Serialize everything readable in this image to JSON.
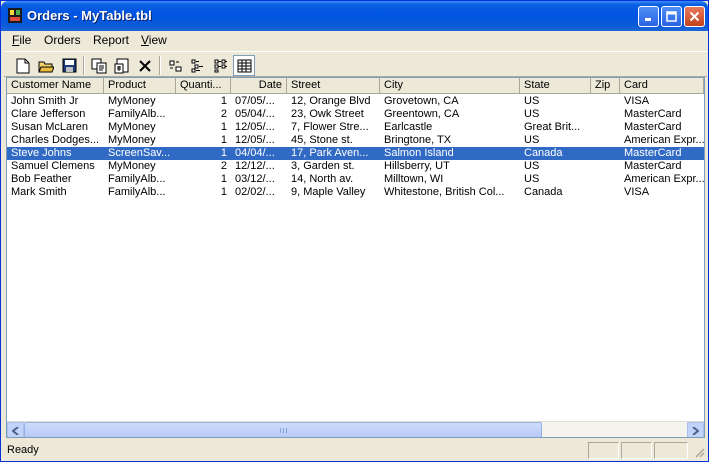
{
  "window": {
    "title": "Orders - MyTable.tbl"
  },
  "menu": [
    "File",
    "Orders",
    "Report",
    "View"
  ],
  "menu_underline": [
    "F",
    "",
    "",
    "V"
  ],
  "toolbar": {
    "buttons": [
      "new-document-icon",
      "open-folder-icon",
      "save-icon",
      "copy-icon",
      "properties-icon",
      "delete-icon",
      "large-icons-view-icon",
      "small-icons-view-icon",
      "list-view-icon",
      "details-view-icon"
    ]
  },
  "table": {
    "columns": [
      "Customer Name",
      "Product",
      "Quanti...",
      "Date",
      "Street",
      "City",
      "State",
      "Zip",
      "Card"
    ],
    "rows": [
      [
        "John Smith Jr",
        "MyMoney",
        "1",
        "07/05/...",
        "12, Orange Blvd",
        "Grovetown, CA",
        "US",
        "",
        "VISA"
      ],
      [
        "Clare Jefferson",
        "FamilyAlb...",
        "2",
        "05/04/...",
        "23, Owk Street",
        "Greentown, CA",
        "US",
        "",
        "MasterCard"
      ],
      [
        "Susan McLaren",
        "MyMoney",
        "1",
        "12/05/...",
        "7, Flower Stre...",
        "Earlcastle",
        "Great Brit...",
        "",
        "MasterCard"
      ],
      [
        "Charles Dodges...",
        "MyMoney",
        "1",
        "12/05/...",
        "45, Stone st.",
        "Bringtone, TX",
        "US",
        "",
        "American Expr..."
      ],
      [
        "Steve Johns",
        "ScreenSav...",
        "1",
        "04/04/...",
        "17, Park Aven...",
        "Salmon Island",
        "Canada",
        "",
        "MasterCard"
      ],
      [
        "Samuel Clemens",
        "MyMoney",
        "2",
        "12/12/...",
        "3, Garden st.",
        "Hillsberry, UT",
        "US",
        "",
        "MasterCard"
      ],
      [
        "Bob Feather",
        "FamilyAlb...",
        "1",
        "03/12/...",
        "14, North av.",
        "Milltown, WI",
        "US",
        "",
        "American Expr..."
      ],
      [
        "Mark Smith",
        "FamilyAlb...",
        "1",
        "02/02/...",
        "9, Maple Valley",
        "Whitestone, British Col...",
        "Canada",
        "",
        "VISA"
      ]
    ],
    "selected_row": 4
  },
  "status": {
    "text": "Ready"
  },
  "colors": {
    "title_bar": "#0054e3",
    "selection": "#316ac5",
    "chrome": "#ece9d8"
  }
}
